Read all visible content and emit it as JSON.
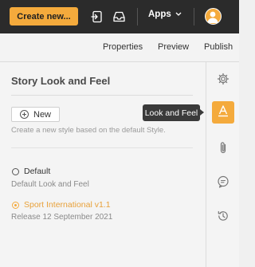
{
  "topbar": {
    "create_label": "Create new...",
    "apps_label": "Apps",
    "icons": [
      "enter-icon",
      "inbox-icon",
      "chevron-down-icon",
      "avatar"
    ]
  },
  "tabs": [
    {
      "label": "Properties"
    },
    {
      "label": "Preview"
    },
    {
      "label": "Publish"
    }
  ],
  "panel": {
    "title": "Story Look and Feel",
    "new_button_label": "New",
    "new_description": "Create a new style based on the default Style.",
    "styles": [
      {
        "name": "Default",
        "description": "Default Look and Feel",
        "selected": false
      },
      {
        "name": "Sport International v1.1",
        "description": "Release 12 September 2021",
        "selected": true
      }
    ]
  },
  "rail": {
    "icons": [
      "gear-icon",
      "look-and-feel-icon",
      "paperclip-icon",
      "comment-icon",
      "history-icon"
    ],
    "active": "look-and-feel-icon"
  },
  "tooltip": {
    "text": "Look and Feel"
  },
  "colors": {
    "accent": "#f4aa3c",
    "topbar": "#2b2b2b"
  }
}
